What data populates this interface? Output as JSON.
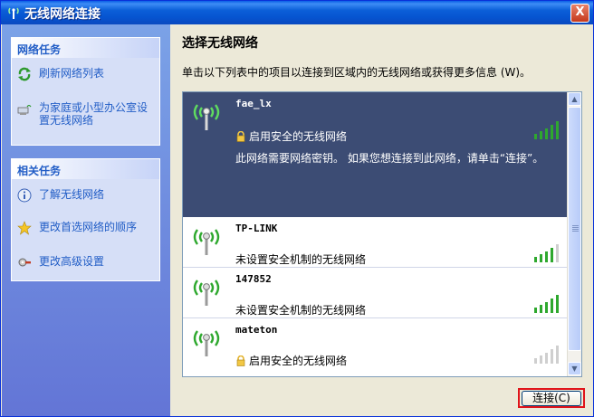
{
  "window": {
    "title": "无线网络连接",
    "close_label": "X"
  },
  "left": {
    "network_tasks": {
      "header": "网络任务",
      "items": [
        {
          "label": "刷新网络列表",
          "icon": "refresh-icon"
        },
        {
          "label": "为家庭或小型办公室设置无线网络",
          "icon": "setup-network-icon"
        }
      ]
    },
    "related_tasks": {
      "header": "相关任务",
      "items": [
        {
          "label": "了解无线网络",
          "icon": "info-icon"
        },
        {
          "label": "更改首选网络的顺序",
          "icon": "star-icon"
        },
        {
          "label": "更改高级设置",
          "icon": "settings-icon"
        }
      ]
    }
  },
  "main": {
    "heading": "选择无线网络",
    "description": "单击以下列表中的项目以连接到区域内的无线网络或获得更多信息 (W)。",
    "networks": [
      {
        "name": "fae_lx",
        "security": "启用安全的无线网络",
        "secured": true,
        "signal": 5,
        "hint": "此网络需要网络密钥。 如果您想连接到此网络，请单击“连接”。",
        "selected": true
      },
      {
        "name": "TP-LINK",
        "security": "未设置安全机制的无线网络",
        "secured": false,
        "signal": 4,
        "selected": false
      },
      {
        "name": "147852",
        "security": "未设置安全机制的无线网络",
        "secured": false,
        "signal": 5,
        "selected": false
      },
      {
        "name": "mateton",
        "security": "启用安全的无线网络",
        "secured": true,
        "signal": 0,
        "selected": false
      }
    ],
    "connect_label": "连接(C)"
  },
  "colors": {
    "accent": "#215dc6",
    "selected_bg": "#3c4c74",
    "signal_green": "#2ea82e",
    "highlight_red": "#e0141a"
  }
}
